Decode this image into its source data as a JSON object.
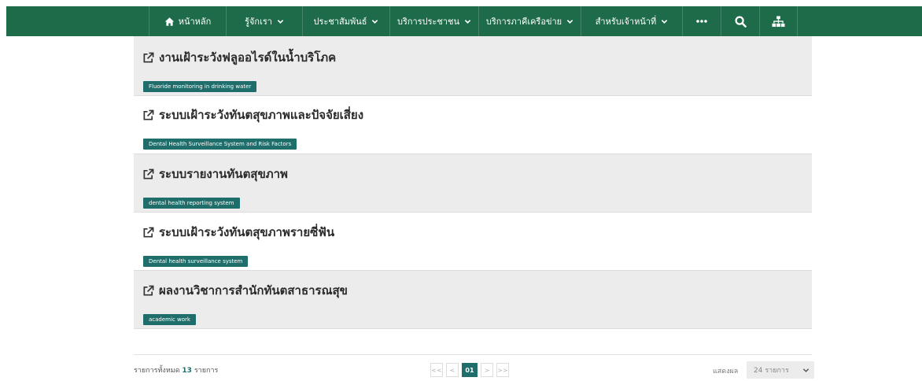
{
  "nav": {
    "items": [
      {
        "label": "หน้าหลัก",
        "icon": "home-icon",
        "caret": false
      },
      {
        "label": "รู้จักเรา",
        "caret": true
      },
      {
        "label": "ประชาสัมพันธ์",
        "caret": true
      },
      {
        "label": "บริการประชาชน",
        "caret": true
      },
      {
        "label": "บริการภาคีเครือข่าย",
        "caret": true
      },
      {
        "label": "สำหรับเจ้าหน้าที่",
        "caret": true
      }
    ],
    "more_icon": "more-icon",
    "search_icon": "search-icon",
    "sitemap_icon": "sitemap-icon",
    "bar_color": "#1e6b4a"
  },
  "list": {
    "items": [
      {
        "title": "งานเฝ้าระวังฟลูออไรด์ในน้ำบริโภค",
        "tag": "Fluoride monitoring in drinking water"
      },
      {
        "title": "ระบบเฝ้าระวังทันตสุขภาพและปัจจัยเสี่ยง",
        "tag": "Dental Health Surveillance System and Risk Factors"
      },
      {
        "title": "ระบบรายงานทันตสุขภาพ",
        "tag": "dental health reporting system"
      },
      {
        "title": "ระบบเฝ้าระวังทันตสุขภาพรายซี่ฟัน",
        "tag": "Dental health surveillance system"
      },
      {
        "title": "ผลงานวิชาการสำนักทันตสาธารณสุข",
        "tag": "academic work"
      }
    ],
    "tag_color": "#1f6e6b"
  },
  "footer": {
    "total_prefix": "รายการทั้งหมด",
    "total_count": "13",
    "total_suffix": "รายการ",
    "pager": {
      "first": "<<",
      "prev": "<",
      "current": "01",
      "next": ">",
      "last": ">>"
    },
    "page_size_label": "แสดงผล",
    "page_size_value": "24 รายการ"
  }
}
